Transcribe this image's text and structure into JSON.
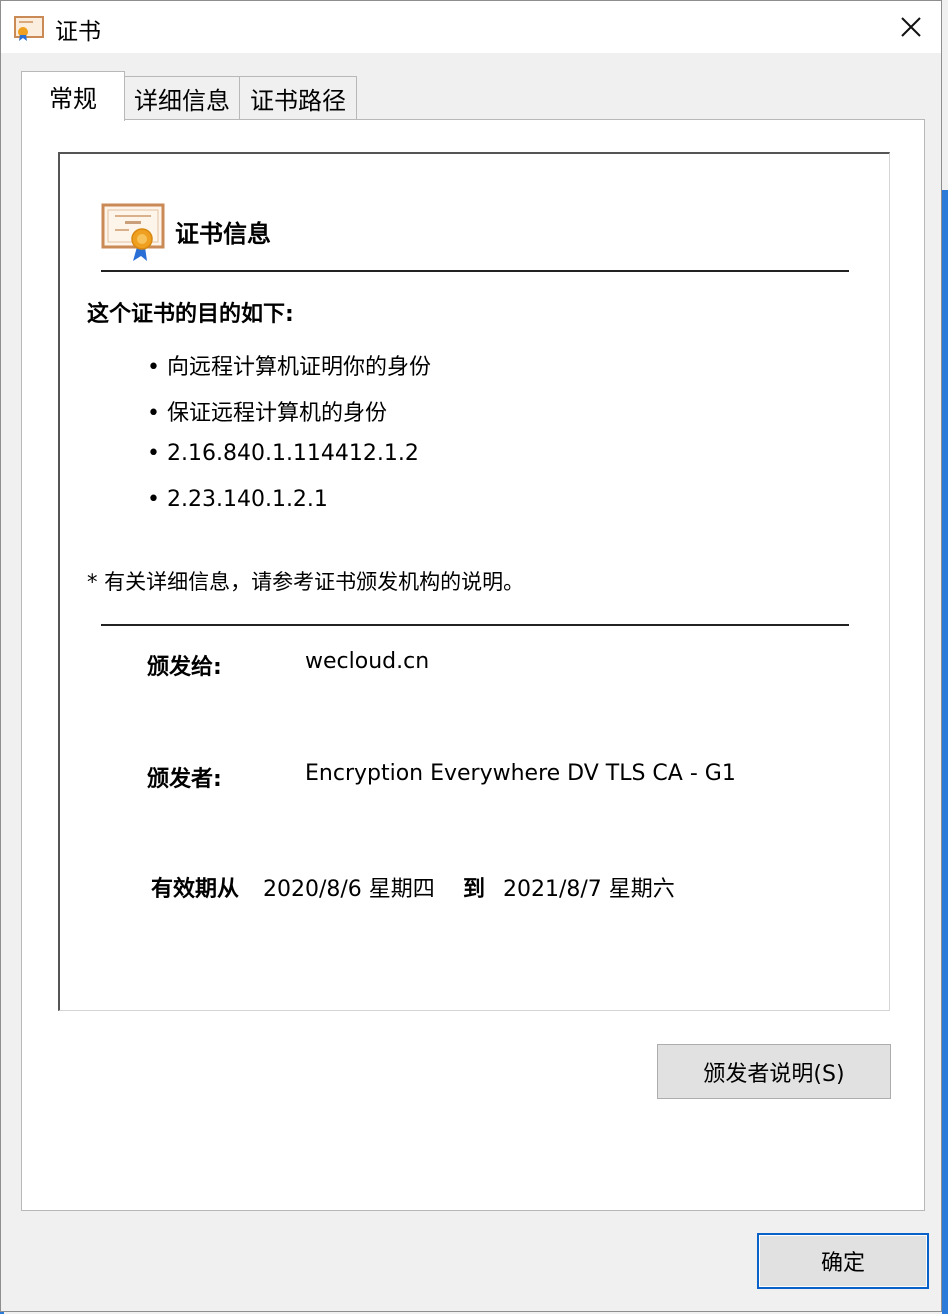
{
  "window": {
    "title": "证书"
  },
  "tabs": [
    {
      "label": "常规"
    },
    {
      "label": "详细信息"
    },
    {
      "label": "证书路径"
    }
  ],
  "cert": {
    "heading": "证书信息",
    "purpose_heading": "这个证书的目的如下:",
    "purposes": [
      "向远程计算机证明你的身份",
      "保证远程计算机的身份",
      "2.16.840.1.114412.1.2",
      "2.23.140.1.2.1"
    ],
    "note": "* 有关详细信息，请参考证书颁发机构的说明。",
    "issued_to_label": "颁发给:",
    "issued_to": "wecloud.cn",
    "issued_by_label": "颁发者:",
    "issued_by": "Encryption Everywhere DV TLS CA - G1",
    "valid_from_label": "有效期从",
    "valid_from": "2020/8/6 星期四",
    "valid_to_label": "到",
    "valid_to": "2021/8/7 星期六"
  },
  "buttons": {
    "issuer_statement": "颁发者说明(S)",
    "ok": "确定"
  },
  "colors": {
    "accent_blue": "#0a62c9",
    "cert_ribbon_orange": "#f0a020",
    "cert_ribbon_blue": "#2a6fd6"
  },
  "icons": {
    "title_icon": "certificate-icon",
    "close_icon": "close-icon",
    "info_icon": "certificate-icon"
  }
}
